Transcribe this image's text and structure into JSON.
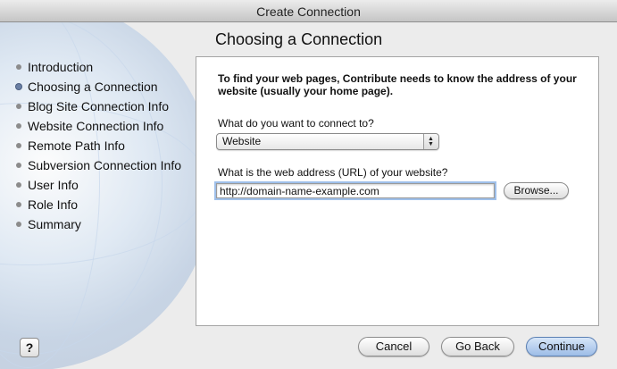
{
  "window": {
    "title": "Create Connection"
  },
  "page": {
    "title": "Choosing a Connection"
  },
  "steps": [
    {
      "label": "Introduction",
      "current": false
    },
    {
      "label": "Choosing a Connection",
      "current": true
    },
    {
      "label": "Blog Site Connection Info",
      "current": false
    },
    {
      "label": "Website Connection Info",
      "current": false
    },
    {
      "label": "Remote Path Info",
      "current": false
    },
    {
      "label": "Subversion Connection Info",
      "current": false
    },
    {
      "label": "User Info",
      "current": false
    },
    {
      "label": "Role Info",
      "current": false
    },
    {
      "label": "Summary",
      "current": false
    }
  ],
  "form": {
    "intro": "To find your web pages, Contribute needs to know the address of your website (usually your home page).",
    "connect_label": "What do you want to connect to?",
    "connect_value": "Website",
    "url_label": "What is the web address (URL) of your website?",
    "url_value": "http://domain-name-example.com",
    "browse_label": "Browse..."
  },
  "footer": {
    "help_label": "?",
    "cancel_label": "Cancel",
    "back_label": "Go Back",
    "continue_label": "Continue"
  },
  "colors": {
    "default_button": "#9dbde7",
    "focus_ring": "#9fc0ea"
  }
}
